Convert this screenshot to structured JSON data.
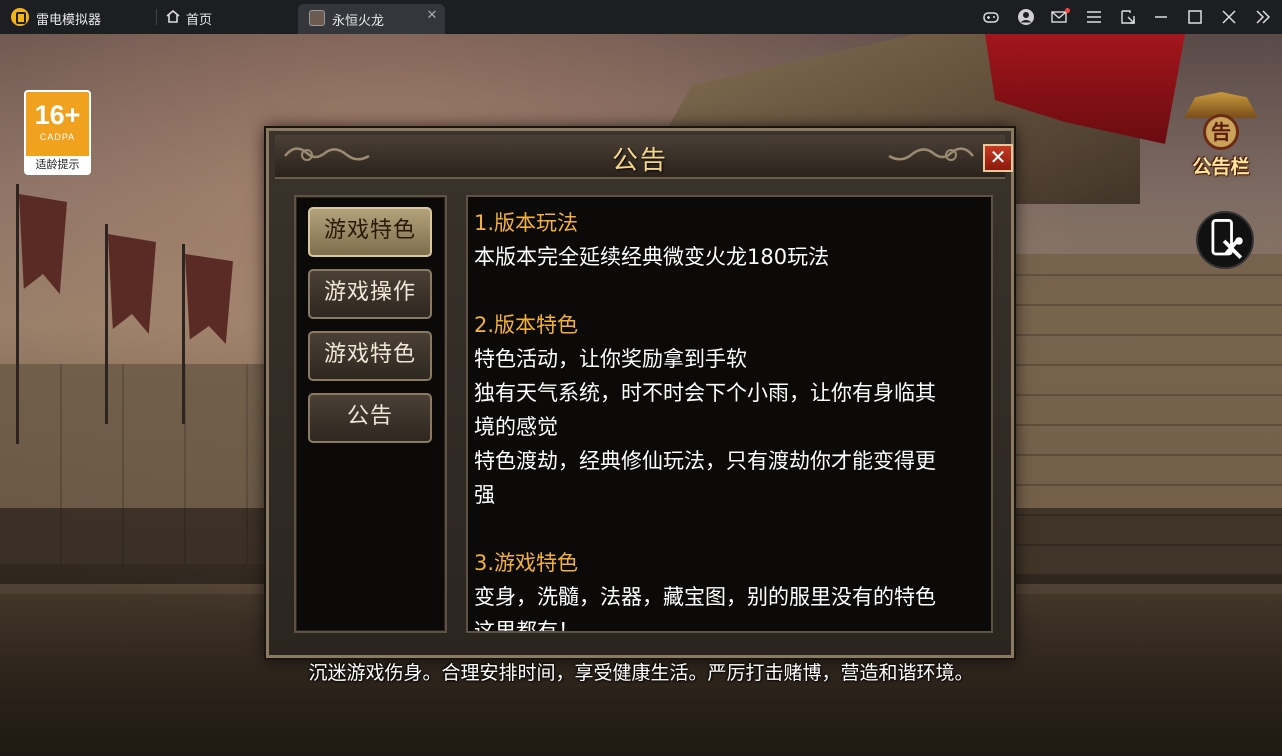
{
  "titlebar": {
    "app_name": "雷电模拟器",
    "home_tab": "首页",
    "active_tab": "永恒火龙",
    "controls": [
      "gamepad-icon",
      "user-icon",
      "mail-icon",
      "menu-icon",
      "resize-icon",
      "minimize-icon",
      "maximize-icon",
      "close-icon",
      "collapse-icon"
    ]
  },
  "age_badge": {
    "rating": "16+",
    "org": "CADPA",
    "tip": "适龄提示"
  },
  "notice_board": {
    "glyph": "告",
    "label": "公告栏"
  },
  "dialog": {
    "title": "公告",
    "close": "✕",
    "nav": [
      "游戏特色",
      "游戏操作",
      "游戏特色",
      "公告"
    ],
    "active_nav": 0,
    "content": {
      "s1_title": "1.版本玩法",
      "s1_line1": "本版本完全延续经典微变火龙180玩法",
      "s2_title": "2.版本特色",
      "s2_line1": "特色活动，让你奖励拿到手软",
      "s2_line2": "独有天气系统，时不时会下个小雨，让你有身临其",
      "s2_line3": "境的感觉",
      "s2_line4": "特色渡劫，经典修仙玩法，只有渡劫你才能变得更",
      "s2_line5": "强",
      "s3_title": "3.游戏特色",
      "s3_line1": "变身，洗髓，法器，藏宝图，别的服里没有的特色",
      "s3_line2": "这里都有！"
    }
  },
  "warning": "沉迷游戏伤身。合理安排时间，享受健康生活。严厉打击赌博，营造和谐环境。",
  "colors": {
    "accent_gold": "#f3b13b",
    "title_gold": "#f4d68a",
    "badge_orange": "#f0a21f",
    "close_red": "#c63a22"
  }
}
